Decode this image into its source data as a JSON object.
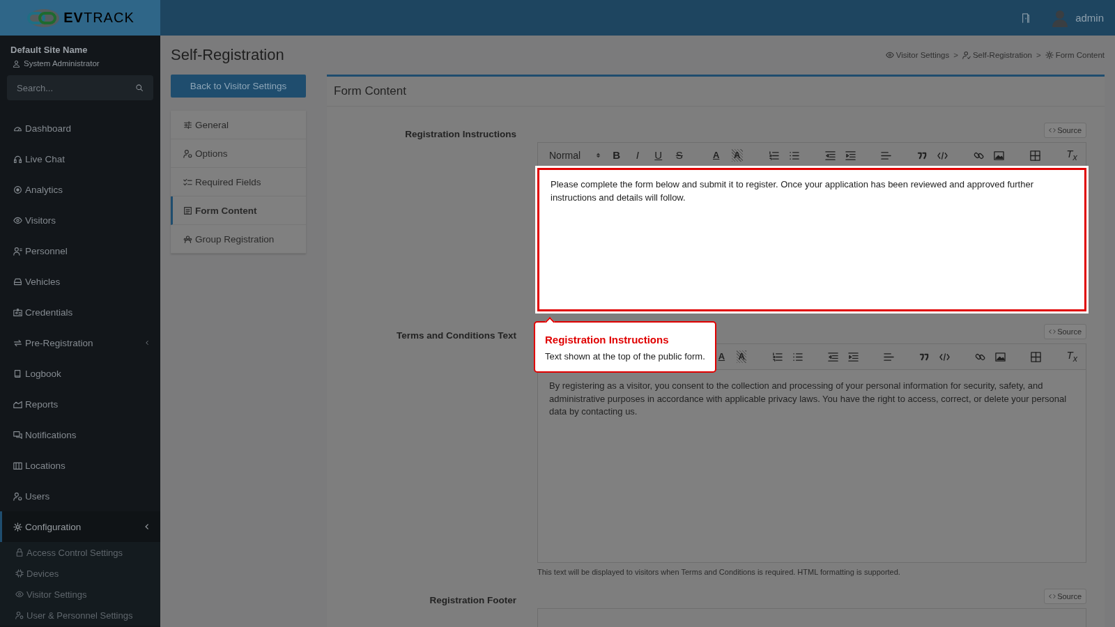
{
  "header": {
    "logo": "**EV**TRACK",
    "user": "admin"
  },
  "sidebar": {
    "site_name": "Default Site Name",
    "role": "System Administrator",
    "search": {
      "placeholder": "Search..."
    },
    "items": [
      {
        "label": "Dashboard",
        "selected": false
      },
      {
        "label": "Live Chat",
        "selected": false
      },
      {
        "label": "Analytics",
        "selected": false
      },
      {
        "label": "Visitors",
        "selected": false
      },
      {
        "label": "Personnel",
        "selected": false
      },
      {
        "label": "Vehicles",
        "selected": false
      },
      {
        "label": "Credentials",
        "selected": false
      },
      {
        "label": "Pre-Registration",
        "selected": false,
        "expanded": false
      },
      {
        "label": "Logbook",
        "selected": false
      },
      {
        "label": "Reports",
        "selected": false
      },
      {
        "label": "Notifications",
        "selected": false
      },
      {
        "label": "Locations",
        "selected": false
      },
      {
        "label": "Users",
        "selected": false
      },
      {
        "label": "Configuration",
        "selected": true,
        "expanded": true,
        "children": [
          {
            "label": "Access Control Settings"
          },
          {
            "label": "Devices"
          },
          {
            "label": "Visitor Settings"
          },
          {
            "label": "User & Personnel Settings"
          }
        ]
      }
    ]
  },
  "page": {
    "title": "Self-Registration",
    "back_button": "Back to Visitor Settings",
    "subnav": [
      {
        "label": "General",
        "selected": false
      },
      {
        "label": "Options",
        "selected": false
      },
      {
        "label": "Required Fields",
        "selected": false
      },
      {
        "label": "Form Content",
        "selected": true
      },
      {
        "label": "Group Registration",
        "selected": false
      }
    ],
    "breadcrumb": [
      "Visitor Settings",
      "Self-Registration",
      "Form Content"
    ],
    "breadcrumb_separators": [
      ">",
      ">"
    ]
  },
  "panel": {
    "title": "Form Content",
    "editors": [
      {
        "label": "Registration Instructions",
        "source_button": "Source",
        "highlighted": true,
        "toolbar": {
          "format": "Normal",
          "marks": [
            "B",
            "I",
            "U",
            "S"
          ],
          "colors": [
            "A",
            "A"
          ],
          "clear": "T$_{x}$"
        },
        "content": "Please complete the form below and submit it to register. Once your application has been reviewed and approved further instructions and details will follow."
      },
      {
        "label": "Terms and Conditions Text",
        "source_button": "Source",
        "highlighted": false,
        "toolbar": {
          "colors": [
            "A",
            "A"
          ],
          "clear": "T$_{x}$"
        },
        "content": "By registering as a visitor, you consent to the collection and processing of your personal information for security, safety, and administrative purposes in accordance with applicable privacy laws. You have the right to access, correct, or delete your personal data by contacting us.",
        "help": "This text will be displayed to visitors when Terms and Conditions is required. HTML formatting is supported."
      },
      {
        "label": "Registration Footer",
        "source_button": "Source",
        "highlighted": false
      }
    ]
  },
  "tour": {
    "title": "Registration Instructions",
    "text": "Text shown at the top of the public form."
  }
}
